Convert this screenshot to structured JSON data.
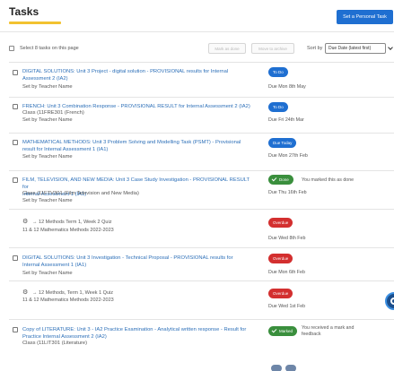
{
  "header": {
    "title": "Tasks",
    "personal_task_label": "Set a Personal Task"
  },
  "toolbar": {
    "select_label": "Select 8 tasks on this page",
    "mark_done_label": "Mark as done",
    "archive_label": "Move to archive",
    "sort_label": "Sort by",
    "sort_value": "Due Date (latest first)"
  },
  "tasks": [
    {
      "title_l1": "DIGITAL SOLUTIONS: Unit 3 Project - digital solution - PROVISIONAL results for Internal",
      "title_l2": "Assessment 2 (IA2)",
      "class": "",
      "setby": "Set by Teacher Name",
      "status": "To Do",
      "due": "Due Mon 8th May"
    },
    {
      "title_l1": "FRENCH: Unit 3 Combination Response - PROVISIONAL RESULT for Internal Assessment 2 (IA2)",
      "title_l2": "",
      "class": "Class (11FRE301 (French)",
      "setby": "Set by Teacher Name",
      "status": "To Do",
      "due": "Due Fri 24th Mar"
    },
    {
      "title_l1": "MATHEMATICAL METHODS: Unit 3 Problem Solving and Modelling Task (PSMT) - Provisional",
      "title_l2": "result for Internal Assessment 1 (IA1)",
      "class": "",
      "setby": "Set by Teacher Name",
      "status": "Due Today",
      "due": "Due Mon 27th Feb"
    },
    {
      "title_l1": "FILM, TELEVISION, AND NEW MEDIA: Unit 3 Case Study Investigation - PROVISIONAL RESULT for",
      "title_l2": "Internal Assessment 1 (IA1)",
      "class": "Class (11FTV301 (Film Television and New Media)",
      "setby": "Set by Teacher Name",
      "status": "Done",
      "note": "You marked this as done",
      "due": "Due Thu 16th Feb"
    },
    {
      "quiz_line": "→ 12 Methods Term 1, Week 2 Quiz",
      "quiz_sub": "11 & 12 Mathematics Methods 2022-2023",
      "status": "Overdue",
      "due": "Due Wed 8th Feb"
    },
    {
      "title_l1": "DIGITAL SOLUTIONS: Unit 3 Investigation - Technical Proposal - PROVISIONAL results for",
      "title_l2": "Internal Assessment 1 (IA1)",
      "setby": "Set by Teacher Name",
      "status": "Overdue",
      "due": "Due Mon 6th Feb"
    },
    {
      "quiz_line": "→ 12 Methods, Term 1, Week 1 Quiz",
      "quiz_sub": "11 & 12 Mathematics Methods 2022-2023",
      "status": "Overdue",
      "due": "Due Wed 1st Feb"
    },
    {
      "title_l1": "Copy of LITERATURE: Unit 3 - IA2 Practice Examination - Analytical written response - Result for",
      "title_l2": "Practice Internal Assessment 2 (IA2)",
      "class": "Class (11LIT301 (Literature)",
      "status": "Marked",
      "note_l1": "You received a mark and",
      "note_l2": "feedback"
    }
  ],
  "colors": {
    "accent": "#1f6fd1",
    "overdue": "#d32f2f",
    "done": "#3a8f3d",
    "link": "#2c6fb8",
    "title_underline": "#f2c230"
  }
}
